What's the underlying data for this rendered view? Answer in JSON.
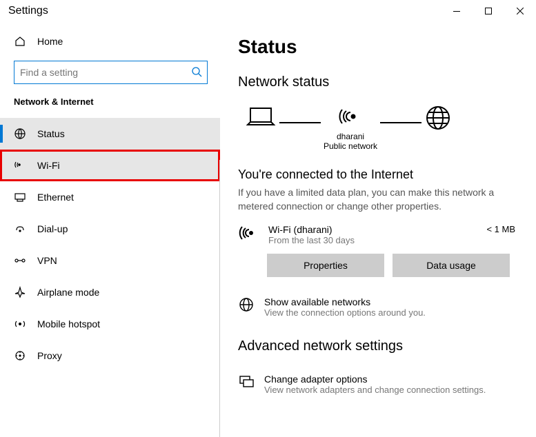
{
  "window": {
    "title": "Settings"
  },
  "sidebar": {
    "home": "Home",
    "search_placeholder": "Find a setting",
    "section": "Network & Internet",
    "items": [
      {
        "label": "Status"
      },
      {
        "label": "Wi-Fi"
      },
      {
        "label": "Ethernet"
      },
      {
        "label": "Dial-up"
      },
      {
        "label": "VPN"
      },
      {
        "label": "Airplane mode"
      },
      {
        "label": "Mobile hotspot"
      },
      {
        "label": "Proxy"
      }
    ]
  },
  "content": {
    "heading": "Status",
    "subheading": "Network status",
    "diagram": {
      "network_name": "dharani",
      "network_type": "Public network"
    },
    "connected_title": "You're connected to the Internet",
    "connected_desc": "If you have a limited data plan, you can make this network a metered connection or change other properties.",
    "connection": {
      "name": "Wi-Fi (dharani)",
      "sub": "From the last 30 days",
      "usage": "< 1 MB"
    },
    "btn_properties": "Properties",
    "btn_data_usage": "Data usage",
    "available": {
      "title": "Show available networks",
      "sub": "View the connection options around you."
    },
    "advanced_heading": "Advanced network settings",
    "adapter": {
      "title": "Change adapter options",
      "sub": "View network adapters and change connection settings."
    }
  }
}
